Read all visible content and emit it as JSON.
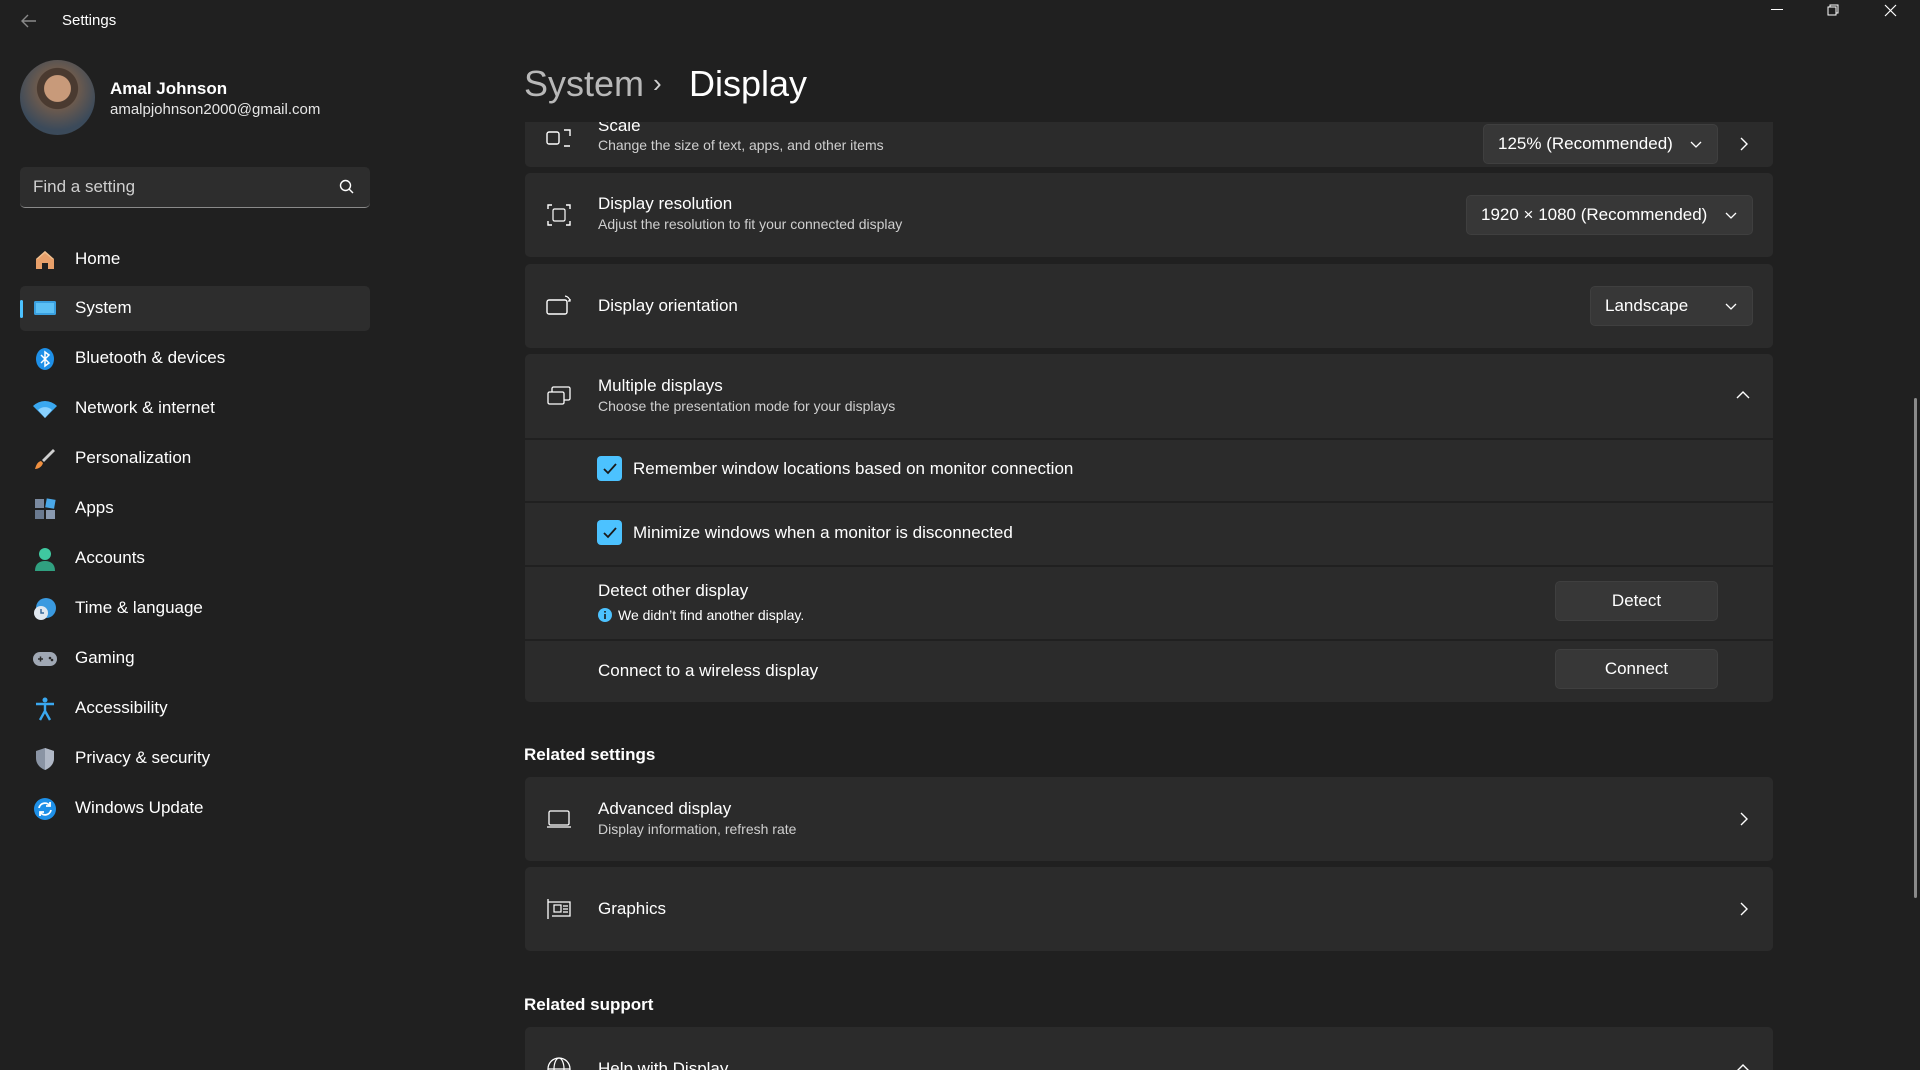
{
  "titlebar": {
    "title": "Settings"
  },
  "user": {
    "name": "Amal Johnson",
    "email": "amalpjohnson2000@gmail.com"
  },
  "search": {
    "placeholder": "Find a setting"
  },
  "sidebar": {
    "items": [
      {
        "label": "Home"
      },
      {
        "label": "System"
      },
      {
        "label": "Bluetooth & devices"
      },
      {
        "label": "Network & internet"
      },
      {
        "label": "Personalization"
      },
      {
        "label": "Apps"
      },
      {
        "label": "Accounts"
      },
      {
        "label": "Time & language"
      },
      {
        "label": "Gaming"
      },
      {
        "label": "Accessibility"
      },
      {
        "label": "Privacy & security"
      },
      {
        "label": "Windows Update"
      }
    ]
  },
  "breadcrumb": {
    "parent": "System",
    "separator": "›",
    "current": "Display"
  },
  "settings": {
    "scale": {
      "title": "Scale",
      "subtitle": "Change the size of text, apps, and other items",
      "value": "125% (Recommended)"
    },
    "resolution": {
      "title": "Display resolution",
      "subtitle": "Adjust the resolution to fit your connected display",
      "value": "1920 × 1080 (Recommended)"
    },
    "orientation": {
      "title": "Display orientation",
      "value": "Landscape"
    },
    "multiple": {
      "title": "Multiple displays",
      "subtitle": "Choose the presentation mode for your displays",
      "remember_label": "Remember window locations based on monitor connection",
      "minimize_label": "Minimize windows when a monitor is disconnected",
      "detect_title": "Detect other display",
      "detect_info": "We didn’t find another display.",
      "detect_button": "Detect",
      "wireless_label": "Connect to a wireless display",
      "connect_button": "Connect"
    }
  },
  "related_settings": {
    "heading": "Related settings",
    "advanced": {
      "title": "Advanced display",
      "subtitle": "Display information, refresh rate"
    },
    "graphics": {
      "title": "Graphics"
    }
  },
  "related_support": {
    "heading": "Related support",
    "help": {
      "title": "Help with Display"
    }
  },
  "colors": {
    "accent": "#4cc2ff",
    "background": "#202020",
    "card": "#2b2b2b"
  }
}
